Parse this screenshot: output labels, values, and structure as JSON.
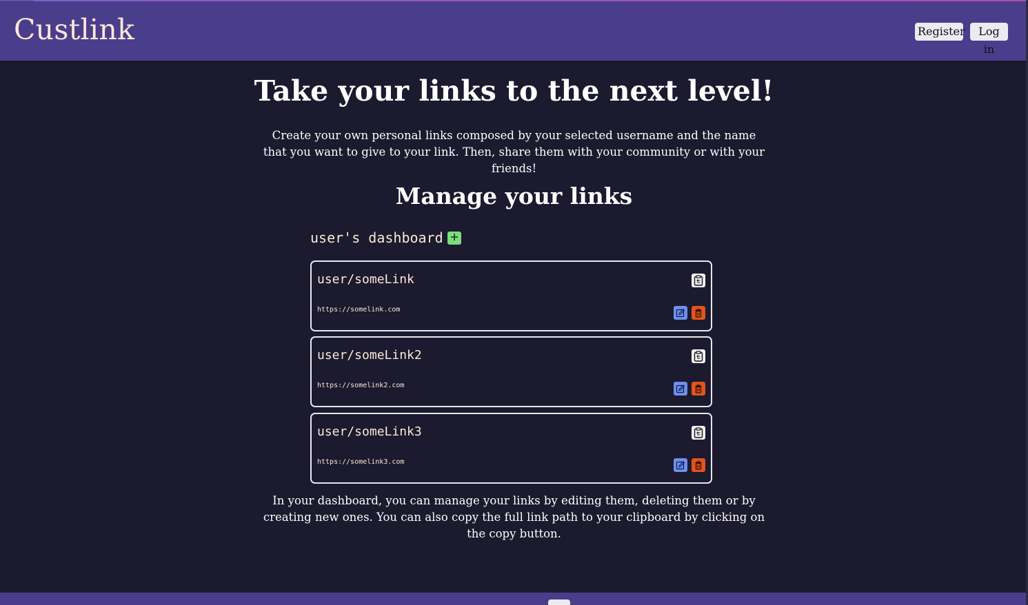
{
  "header": {
    "logo": "Custlink",
    "register_label": "Register",
    "login_label": "Log in"
  },
  "hero": {
    "title": "Take your links to the next level!",
    "text": "Create your own personal links composed by your selected username and the name that you want to give to your link. Then, share them with your community or with your friends!"
  },
  "manage": {
    "title": "Manage your links",
    "dashboard_title": "user's dashboard",
    "add_icon": "plus-icon"
  },
  "links": [
    {
      "short": "user/someLink",
      "url": "https://somelink.com"
    },
    {
      "short": "user/someLink2",
      "url": "https://somelink2.com"
    },
    {
      "short": "user/someLink3",
      "url": "https://somelink3.com"
    }
  ],
  "icons": {
    "copy": "clipboard-icon",
    "edit": "edit-icon",
    "delete": "trash-icon"
  },
  "explanation": "In your dashboard, you can manage your links by editing them, deleting them or by creating new ones. You can also copy the full link path to your clipboard by clicking on the copy button.",
  "colors": {
    "header_bg": "#4a3e8c",
    "page_bg": "#1b1a2e",
    "accent_text": "#fbe8d6",
    "add_green": "#7ddc7f",
    "edit_blue": "#6f8fe8",
    "delete_orange": "#e0541e"
  }
}
